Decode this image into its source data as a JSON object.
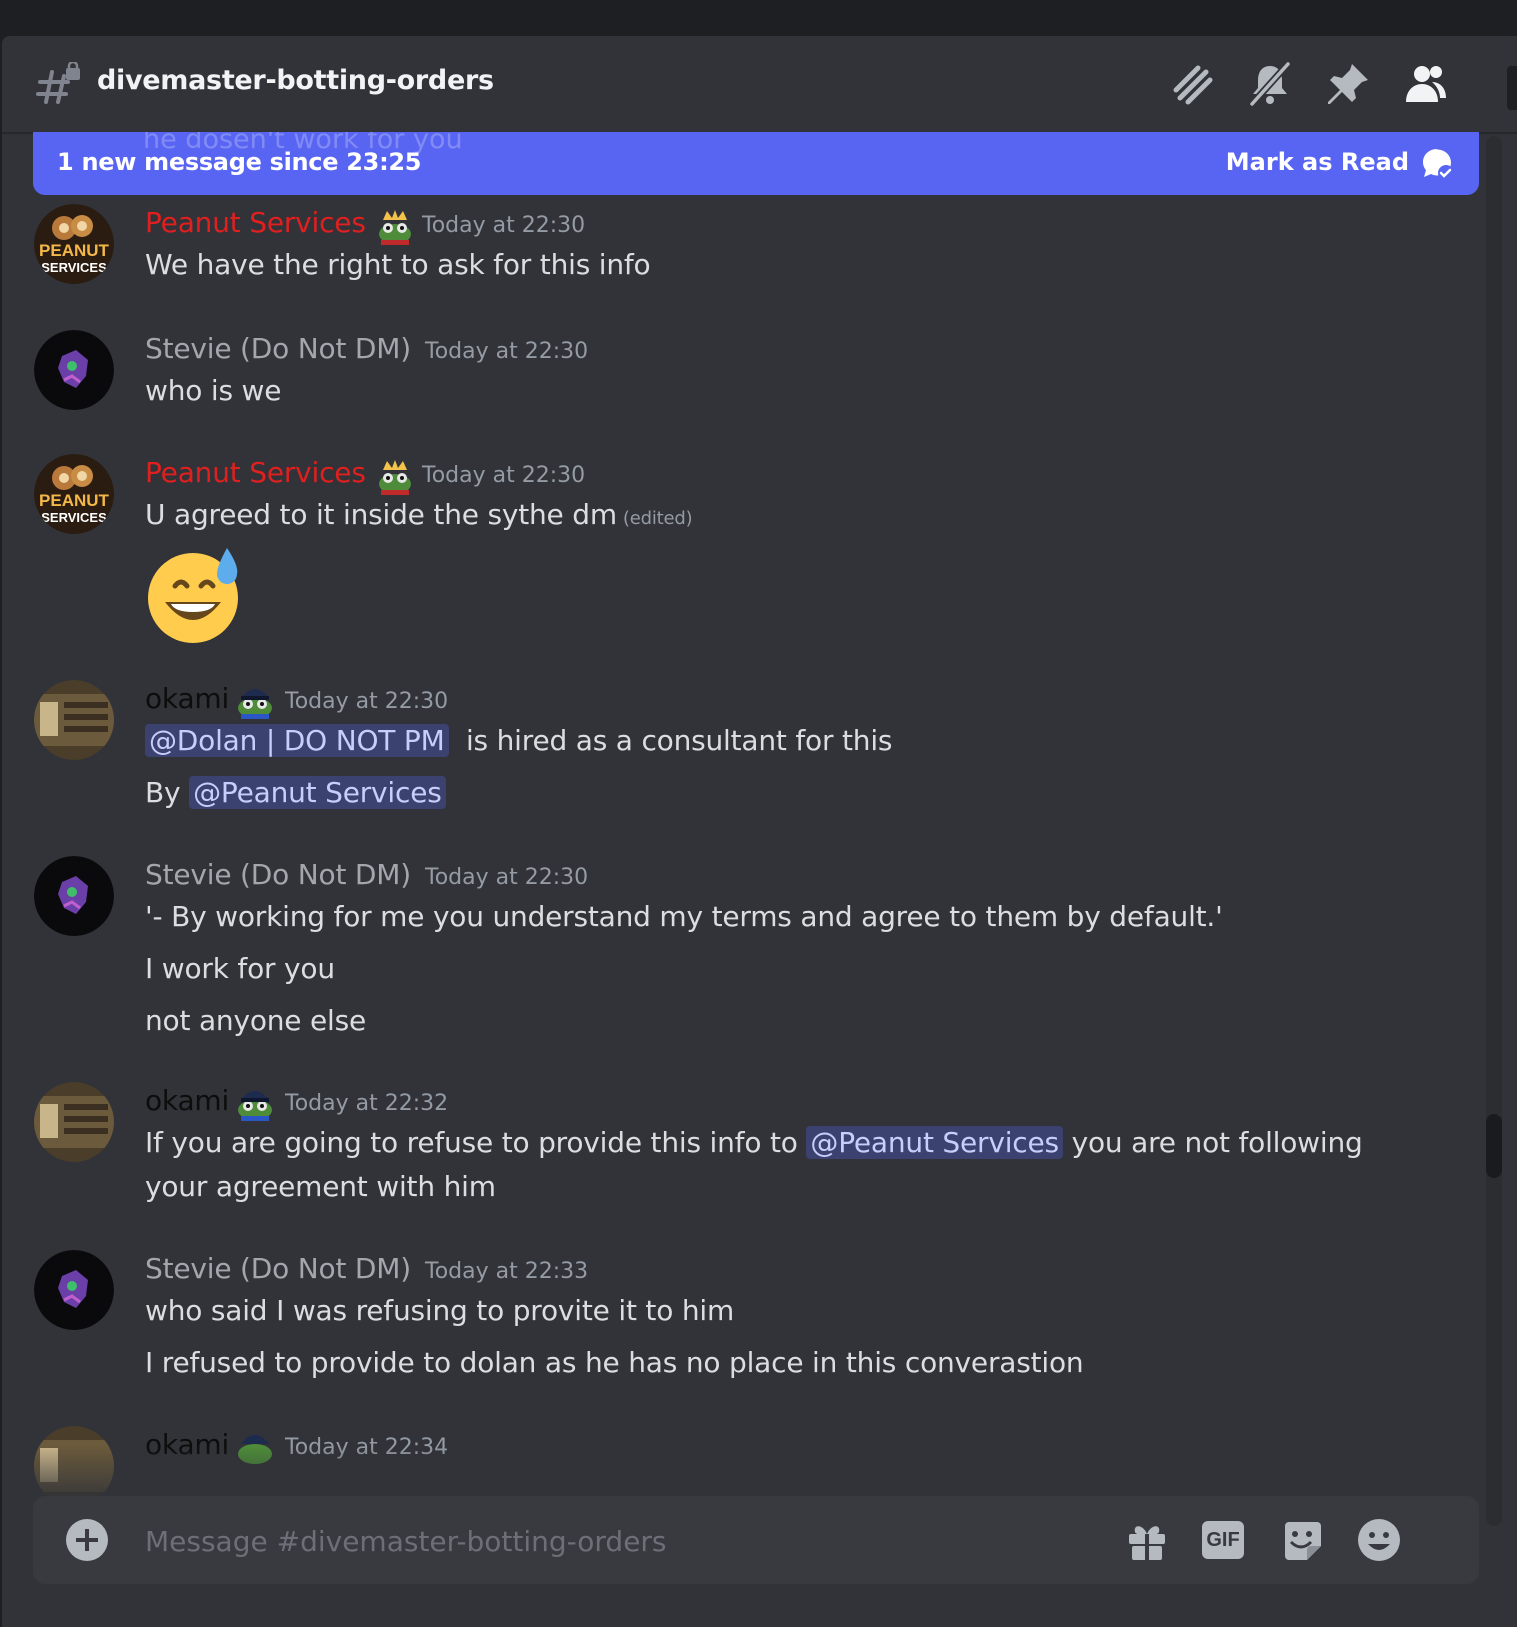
{
  "channel": {
    "name": "divemaster-botting-orders",
    "ghost_text": "he dosen't work for you"
  },
  "new_messages_bar": {
    "text": "1 new message since 23:25",
    "action": "Mark as Read"
  },
  "header_icons": [
    "threads-icon",
    "bell-muted-icon",
    "pin-icon",
    "members-icon"
  ],
  "messages": [
    {
      "author": "Peanut Services",
      "author_color": "#e01f1f",
      "avatar_text": [
        "PEANUT",
        "SERVICES"
      ],
      "timestamp": "Today at 22:30",
      "lines": [
        "We have the right to ask for this info"
      ]
    },
    {
      "author": "Stevie (Do Not DM)",
      "timestamp": "Today at 22:30",
      "lines": [
        "who is we"
      ]
    },
    {
      "author": "Peanut Services",
      "timestamp": "Today at 22:30",
      "lines": [
        "U agreed to it inside the sythe dm"
      ],
      "edited": "(edited)",
      "emoji": "grinning-sweat-emoji"
    },
    {
      "author": "okami",
      "timestamp": "Today at 22:30",
      "mention1": "@Dolan | DO NOT PM",
      "line1_rest": "is hired as a consultant for this",
      "line2_prefix": "By",
      "mention2": "@Peanut Services"
    },
    {
      "author": "Stevie (Do Not DM)",
      "timestamp": "Today at 22:30",
      "lines": [
        "'- By working for me you understand my terms and agree to them by default.'",
        "I work for you",
        "not anyone else"
      ]
    },
    {
      "author": "okami",
      "timestamp": "Today at 22:32",
      "line1_prefix": "If you are going to refuse to provide this info to",
      "mention": "@Peanut Services",
      "line1_suffix": "you are not following",
      "line2": "your agreement with him"
    },
    {
      "author": "Stevie (Do Not DM)",
      "timestamp": "Today at 22:33",
      "lines": [
        "who said I was refusing to provite it to him",
        "I refused to provide to dolan as he has no place in this converastion"
      ]
    },
    {
      "author": "okami",
      "timestamp": "Today at 22:34"
    }
  ],
  "composer": {
    "placeholder": "Message #divemaster-botting-orders",
    "gif_label": "GIF"
  }
}
